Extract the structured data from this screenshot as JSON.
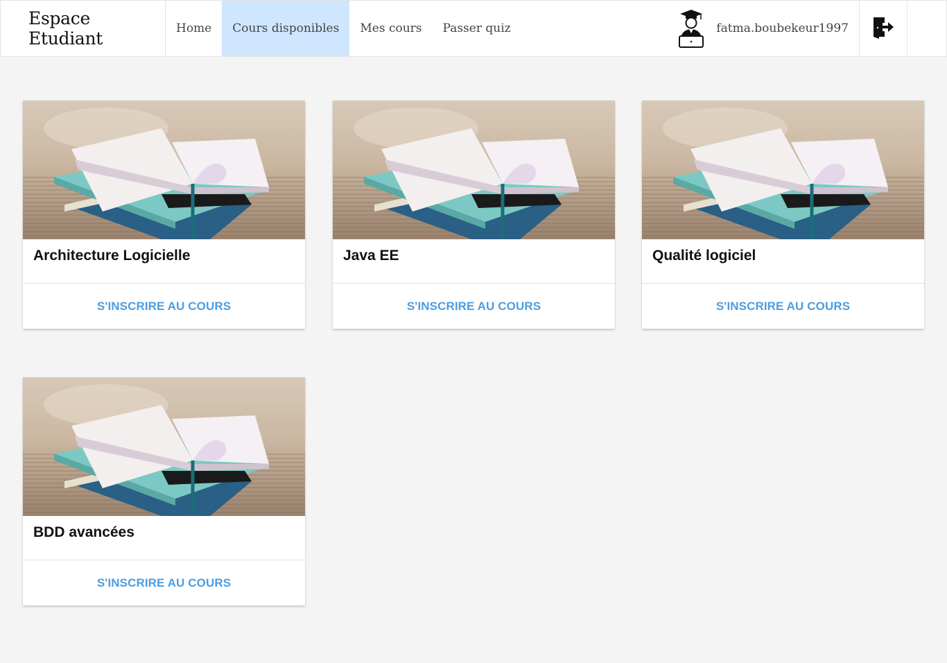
{
  "navbar": {
    "brand": "Espace Etudiant",
    "links": [
      {
        "label": "Home",
        "active": false
      },
      {
        "label": "Cours disponibles",
        "active": true
      },
      {
        "label": "Mes cours",
        "active": false
      },
      {
        "label": "Passer quiz",
        "active": false
      }
    ],
    "username": "fatma.boubekeur1997",
    "avatar_icon": "student-graduate-icon",
    "logout_icon": "logout-door-icon"
  },
  "colors": {
    "active_tab_bg": "#cfe6ff",
    "action_text": "#4b9de0",
    "page_bg": "#f4f4f4"
  },
  "courses": [
    {
      "title": "Architecture Logicielle",
      "action": "S'inscrire au cours",
      "image_icon": "book-stack-image"
    },
    {
      "title": "Java EE",
      "action": "S'inscrire au cours",
      "image_icon": "book-stack-image"
    },
    {
      "title": "Qualité logiciel",
      "action": "S'inscrire au cours",
      "image_icon": "book-stack-image"
    },
    {
      "title": "BDD avancées",
      "action": "S'inscrire au cours",
      "image_icon": "book-stack-image"
    }
  ]
}
